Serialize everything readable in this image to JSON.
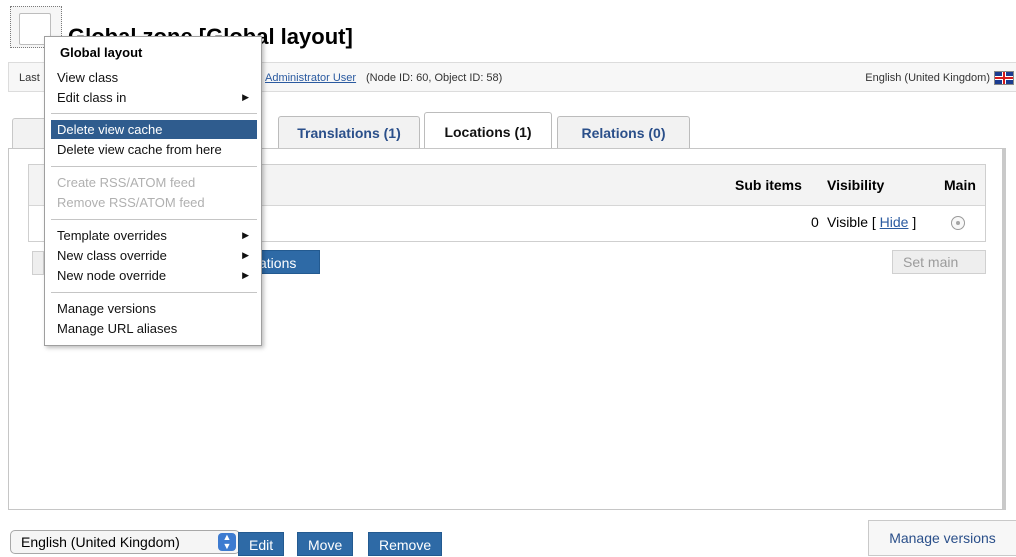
{
  "header": {
    "title": "Global zone [Global layout]",
    "info_left": "Last",
    "info_link": "Administrator User",
    "info_meta": "(Node ID: 60, Object ID: 58)",
    "language": "English (United Kingdom)"
  },
  "tabs": [
    {
      "label": "Translations (1)",
      "active": false
    },
    {
      "label": "Locations (1)",
      "active": true
    },
    {
      "label": "Relations (0)",
      "active": false
    }
  ],
  "locations_table": {
    "headers": [
      "Sub items",
      "Visibility",
      "Main"
    ],
    "row": {
      "sub_items": "0",
      "visibility": "Visible",
      "visibility_open": "[",
      "hide_link": "Hide",
      "visibility_close": "]"
    }
  },
  "buttons": {
    "add_locations_partial": "ations",
    "set_main": "Set main"
  },
  "bottom_bar": {
    "language_select": "English (United Kingdom)",
    "edit": "Edit",
    "move": "Move",
    "remove": "Remove",
    "manage_versions": "Manage versions"
  },
  "context_menu": {
    "title": "Global layout",
    "items": [
      {
        "label": "View class",
        "disabled": false,
        "submenu": false
      },
      {
        "label": "Edit class in",
        "disabled": false,
        "submenu": true
      },
      {
        "label": "Delete view cache",
        "disabled": false,
        "submenu": false,
        "highlighted": true
      },
      {
        "label": "Delete view cache from here",
        "disabled": false,
        "submenu": false
      },
      {
        "label": "Create RSS/ATOM feed",
        "disabled": true,
        "submenu": false
      },
      {
        "label": "Remove RSS/ATOM feed",
        "disabled": true,
        "submenu": false
      },
      {
        "label": "Template overrides",
        "disabled": false,
        "submenu": true
      },
      {
        "label": "New class override",
        "disabled": false,
        "submenu": true
      },
      {
        "label": "New node override",
        "disabled": false,
        "submenu": true
      },
      {
        "label": "Manage versions",
        "disabled": false,
        "submenu": false
      },
      {
        "label": "Manage URL aliases",
        "disabled": false,
        "submenu": false
      }
    ]
  },
  "colors": {
    "accent_blue": "#2e6aa6",
    "menu_highlight": "#2f5c8e",
    "link": "#2a5aa0"
  },
  "icons": {
    "node_icon": "page-icon",
    "language_flag": "uk-flag-icon",
    "submenu_arrow": "triangle-right-icon",
    "select_arrow": "updown-arrows-icon"
  }
}
